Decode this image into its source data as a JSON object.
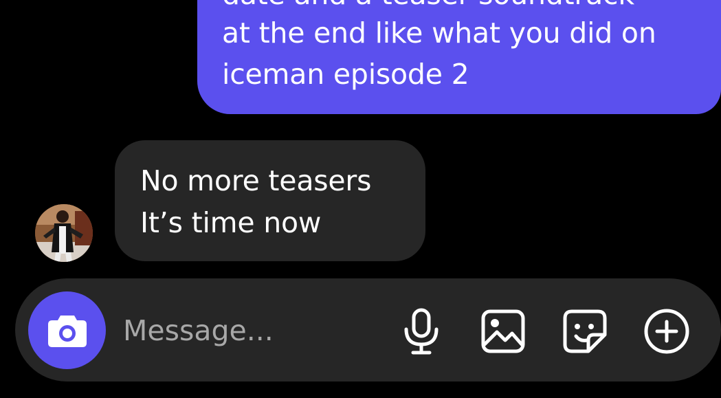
{
  "thread": {
    "sent_message": {
      "lines": [
        "date and a teaser soundtrack",
        "at the end like what you did on",
        "iceman episode 2"
      ]
    },
    "received_message": {
      "lines": [
        "No more teasers",
        "It’s time now"
      ],
      "sender_avatar_icon": "profile-photo"
    }
  },
  "composer": {
    "placeholder": "Message...",
    "value": "",
    "camera_icon": "camera-icon",
    "tools": [
      {
        "name": "microphone-icon"
      },
      {
        "name": "gallery-icon"
      },
      {
        "name": "sticker-icon"
      },
      {
        "name": "plus-circle-icon"
      }
    ]
  },
  "colors": {
    "background": "#000000",
    "sent_bubble": "#5b50ee",
    "received_bubble": "#262626",
    "composer": "#262626",
    "accent": "#5b50ee",
    "text": "#ffffff",
    "placeholder": "#a8a8a8"
  }
}
